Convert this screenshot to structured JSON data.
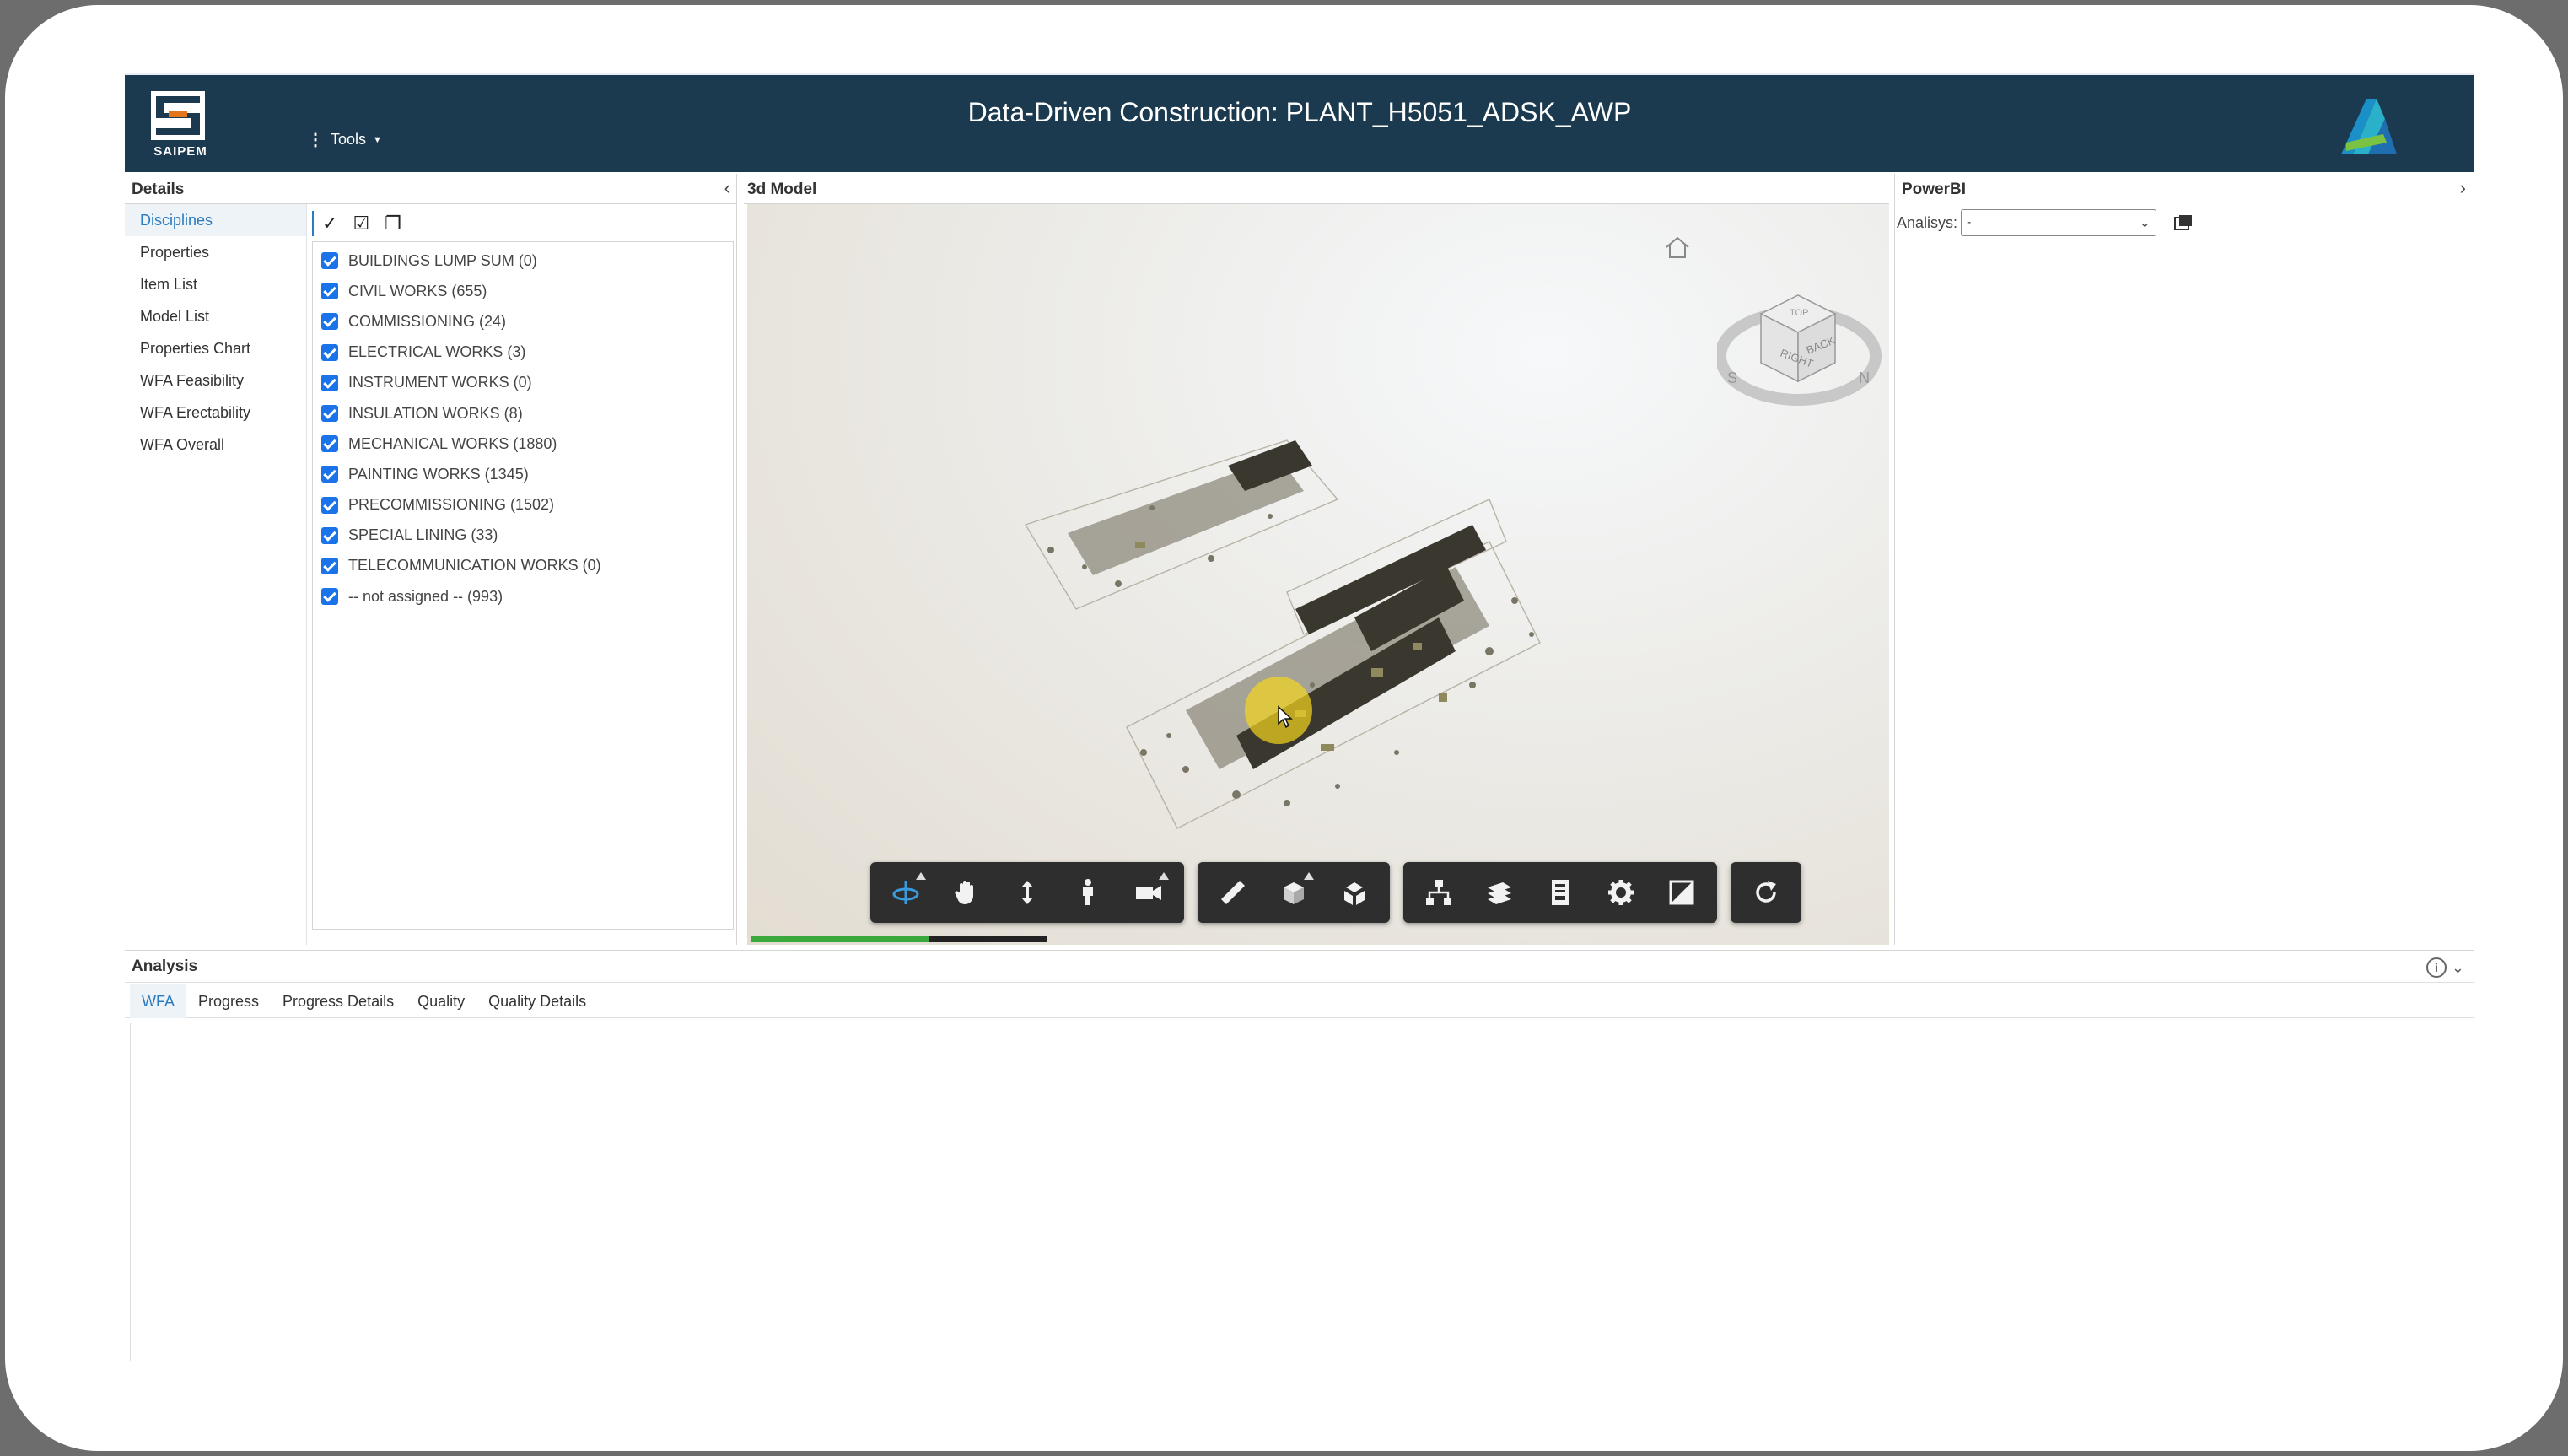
{
  "header": {
    "logo_text": "SAIPEM",
    "tools_label": "Tools",
    "title": "Data-Driven Construction: PLANT_H5051_ADSK_AWP"
  },
  "details": {
    "title": "Details",
    "nav": [
      {
        "label": "Disciplines",
        "active": true
      },
      {
        "label": "Properties"
      },
      {
        "label": "Item List"
      },
      {
        "label": "Model List"
      },
      {
        "label": "Properties Chart"
      },
      {
        "label": "WFA Feasibility"
      },
      {
        "label": "WFA Erectability"
      },
      {
        "label": "WFA Overall"
      }
    ],
    "disciplines": [
      {
        "label": "BUILDINGS LUMP SUM (0)",
        "checked": true
      },
      {
        "label": "CIVIL WORKS (655)",
        "checked": true
      },
      {
        "label": "COMMISSIONING (24)",
        "checked": true
      },
      {
        "label": "ELECTRICAL WORKS (3)",
        "checked": true
      },
      {
        "label": "INSTRUMENT WORKS (0)",
        "checked": true
      },
      {
        "label": "INSULATION WORKS (8)",
        "checked": true
      },
      {
        "label": "MECHANICAL WORKS (1880)",
        "checked": true
      },
      {
        "label": "PAINTING WORKS (1345)",
        "checked": true
      },
      {
        "label": "PRECOMMISSIONING (1502)",
        "checked": true
      },
      {
        "label": "SPECIAL LINING (33)",
        "checked": true
      },
      {
        "label": "TELECOMMUNICATION WORKS (0)",
        "checked": true
      },
      {
        "label": "-- not assigned -- (993)",
        "checked": true
      }
    ]
  },
  "model": {
    "title": "3d Model",
    "loading_progress": 0.6,
    "viewcube_faces": [
      "RIGHT",
      "BACK",
      "TOP"
    ],
    "compass": [
      "S",
      "N"
    ]
  },
  "powerbi": {
    "title": "PowerBI",
    "analysis_label": "Analisys:",
    "analysis_value": "-"
  },
  "analysis": {
    "title": "Analysis",
    "tabs": [
      {
        "label": "WFA",
        "active": true
      },
      {
        "label": "Progress"
      },
      {
        "label": "Progress Details"
      },
      {
        "label": "Quality"
      },
      {
        "label": "Quality Details"
      }
    ]
  },
  "colors": {
    "header_bg": "#1c3a4f",
    "accent": "#2b7bbf",
    "checkbox": "#1a73e8",
    "toolbar": "#2e2e2e",
    "orbit_active": "#3a9bdc",
    "progress": "#3aa83a"
  }
}
